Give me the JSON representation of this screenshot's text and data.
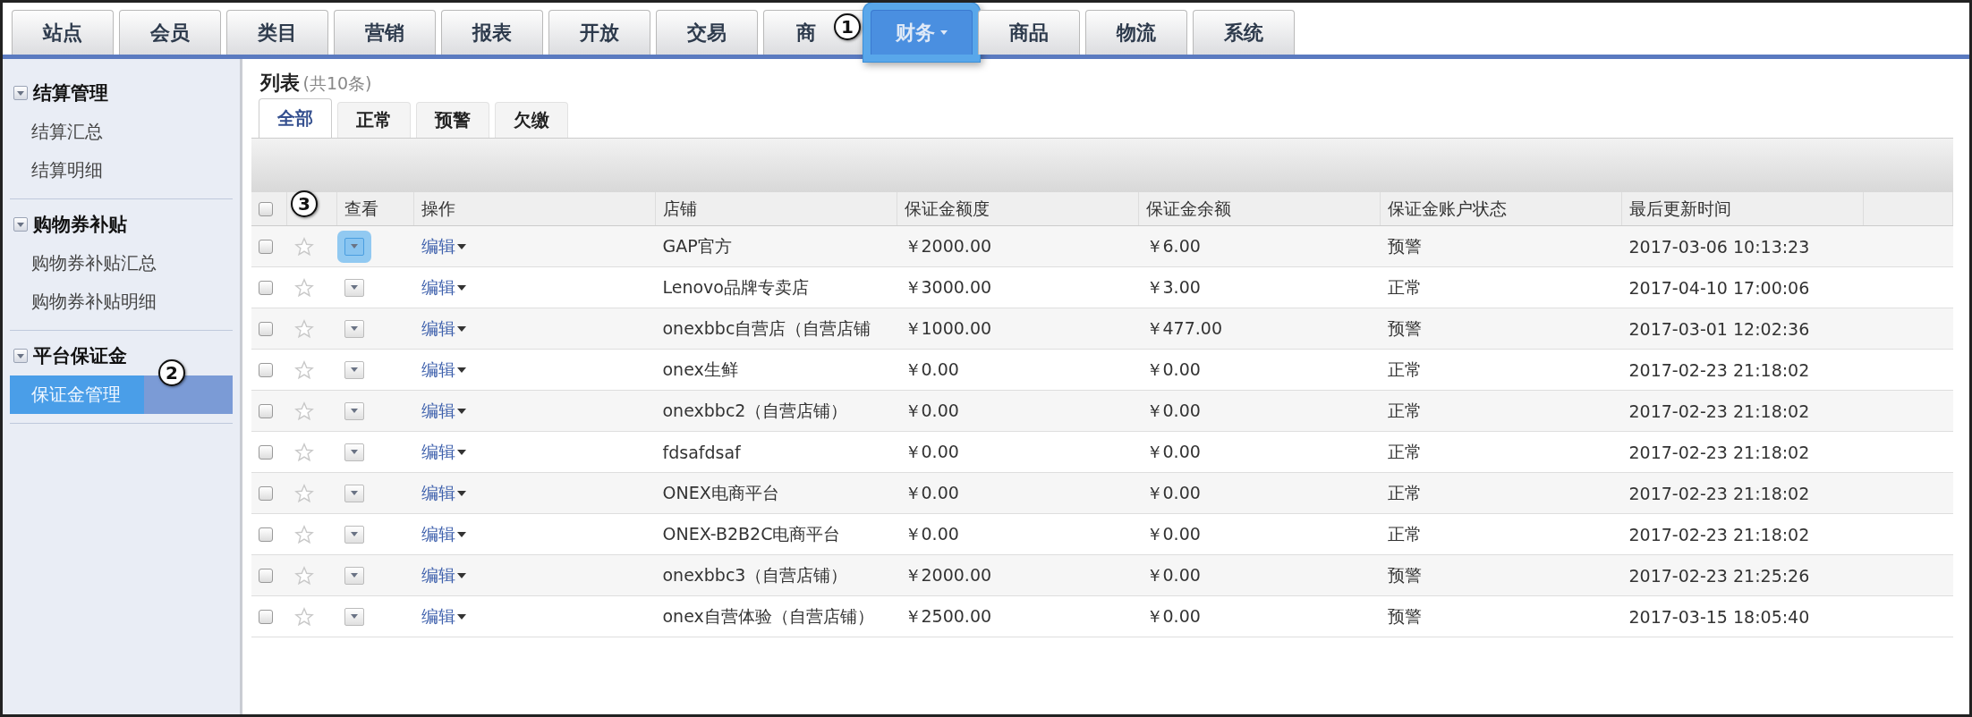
{
  "top_nav": [
    {
      "label": "站点",
      "selected": false,
      "dropdown": false,
      "highlighted": false
    },
    {
      "label": "会员",
      "selected": false,
      "dropdown": false,
      "highlighted": false
    },
    {
      "label": "类目",
      "selected": false,
      "dropdown": false,
      "highlighted": false
    },
    {
      "label": "营销",
      "selected": false,
      "dropdown": false,
      "highlighted": false
    },
    {
      "label": "报表",
      "selected": false,
      "dropdown": false,
      "highlighted": false
    },
    {
      "label": "开放",
      "selected": false,
      "dropdown": false,
      "highlighted": false
    },
    {
      "label": "交易",
      "selected": false,
      "dropdown": false,
      "highlighted": false
    },
    {
      "label": "商",
      "selected": false,
      "dropdown": false,
      "highlighted": false,
      "callout": "1"
    },
    {
      "label": "财务",
      "selected": true,
      "dropdown": true,
      "highlighted": true
    },
    {
      "label": "商品",
      "selected": false,
      "dropdown": false,
      "highlighted": false
    },
    {
      "label": "物流",
      "selected": false,
      "dropdown": false,
      "highlighted": false
    },
    {
      "label": "系统",
      "selected": false,
      "dropdown": false,
      "highlighted": false
    }
  ],
  "sidebar": {
    "groups": [
      {
        "title": "结算管理",
        "expanded": true,
        "items": [
          {
            "label": "结算汇总",
            "selected": false,
            "highlighted": false
          },
          {
            "label": "结算明细",
            "selected": false,
            "highlighted": false
          }
        ]
      },
      {
        "title": "购物券补贴",
        "expanded": true,
        "items": [
          {
            "label": "购物券补贴汇总",
            "selected": false,
            "highlighted": false
          },
          {
            "label": "购物券补贴明细",
            "selected": false,
            "highlighted": false
          }
        ]
      },
      {
        "title": "平台保证金",
        "expanded": true,
        "items": [
          {
            "label": "保证金管理",
            "selected": true,
            "highlighted": true,
            "callout": "2"
          }
        ]
      }
    ]
  },
  "content": {
    "title": "列表",
    "count": "(共10条)",
    "tabs": [
      {
        "label": "全部",
        "selected": true
      },
      {
        "label": "正常",
        "selected": false
      },
      {
        "label": "预警",
        "selected": false
      },
      {
        "label": "欠缴",
        "selected": false
      }
    ],
    "table": {
      "header_checked": false,
      "header_callout": "3",
      "columns": [
        "查看",
        "操作",
        "店铺",
        "保证金额度",
        "保证金余额",
        "保证金账户状态",
        "最后更新时间"
      ],
      "rows": [
        {
          "checked": false,
          "starred": false,
          "view_highlighted": true,
          "action": "编辑",
          "shop": "GAP官方",
          "quota": "￥2000.00",
          "balance": "￥6.00",
          "status": "预警",
          "updated": "2017-03-06 10:13:23"
        },
        {
          "checked": false,
          "starred": false,
          "view_highlighted": false,
          "action": "编辑",
          "shop": "Lenovo品牌专卖店",
          "quota": "￥3000.00",
          "balance": "￥3.00",
          "status": "正常",
          "updated": "2017-04-10 17:00:06"
        },
        {
          "checked": false,
          "starred": false,
          "view_highlighted": false,
          "action": "编辑",
          "shop": "onexbbc自营店（自营店铺",
          "quota": "￥1000.00",
          "balance": "￥477.00",
          "status": "预警",
          "updated": "2017-03-01 12:02:36"
        },
        {
          "checked": false,
          "starred": false,
          "view_highlighted": false,
          "action": "编辑",
          "shop": "onex生鲜",
          "quota": "￥0.00",
          "balance": "￥0.00",
          "status": "正常",
          "updated": "2017-02-23 21:18:02"
        },
        {
          "checked": false,
          "starred": false,
          "view_highlighted": false,
          "action": "编辑",
          "shop": "onexbbc2（自营店铺）",
          "quota": "￥0.00",
          "balance": "￥0.00",
          "status": "正常",
          "updated": "2017-02-23 21:18:02"
        },
        {
          "checked": false,
          "starred": false,
          "view_highlighted": false,
          "action": "编辑",
          "shop": "fdsafdsaf",
          "quota": "￥0.00",
          "balance": "￥0.00",
          "status": "正常",
          "updated": "2017-02-23 21:18:02"
        },
        {
          "checked": false,
          "starred": false,
          "view_highlighted": false,
          "action": "编辑",
          "shop": "ONEX电商平台",
          "quota": "￥0.00",
          "balance": "￥0.00",
          "status": "正常",
          "updated": "2017-02-23 21:18:02"
        },
        {
          "checked": false,
          "starred": false,
          "view_highlighted": false,
          "action": "编辑",
          "shop": "ONEX-B2B2C电商平台",
          "quota": "￥0.00",
          "balance": "￥0.00",
          "status": "正常",
          "updated": "2017-02-23 21:18:02"
        },
        {
          "checked": false,
          "starred": false,
          "view_highlighted": false,
          "action": "编辑",
          "shop": "onexbbc3（自营店铺）",
          "quota": "￥2000.00",
          "balance": "￥0.00",
          "status": "预警",
          "updated": "2017-02-23 21:25:26"
        },
        {
          "checked": false,
          "starred": false,
          "view_highlighted": false,
          "action": "编辑",
          "shop": "onex自营体验（自营店铺）",
          "quota": "￥2500.00",
          "balance": "￥0.00",
          "status": "预警",
          "updated": "2017-03-15 18:05:40"
        }
      ]
    }
  }
}
